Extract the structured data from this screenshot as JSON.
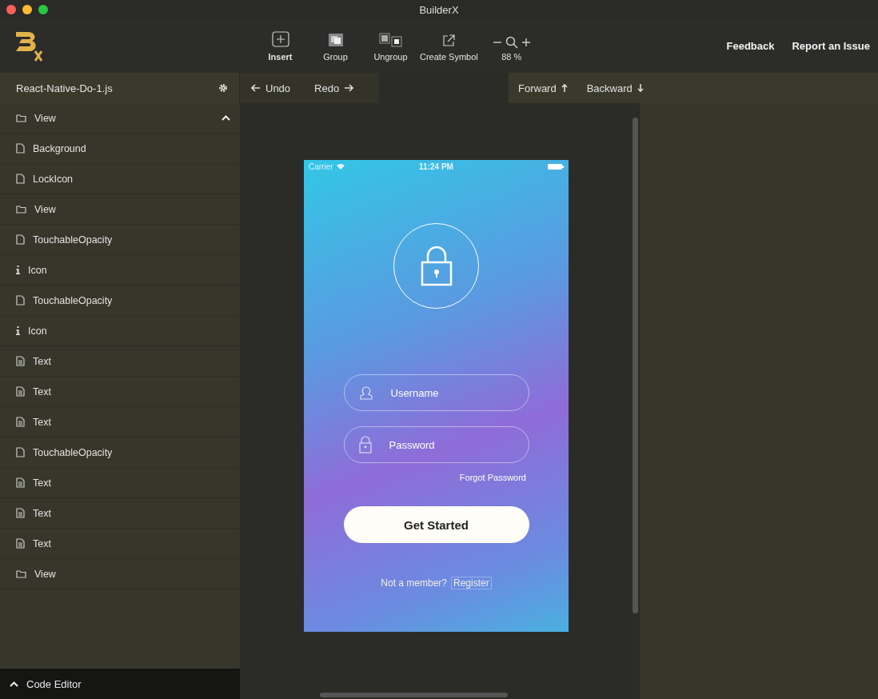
{
  "window": {
    "title": "BuilderX"
  },
  "toolbar": {
    "tools": [
      {
        "label": "Insert",
        "kind": "insert",
        "selected": true
      },
      {
        "label": "Group",
        "kind": "group",
        "selected": false
      },
      {
        "label": "Ungroup",
        "kind": "ungroup",
        "selected": false
      },
      {
        "label": "Create Symbol",
        "kind": "symbol",
        "selected": false
      }
    ],
    "zoom": "88 %",
    "links": [
      "Feedback",
      "Report an Issue"
    ]
  },
  "file": {
    "name": "React-Native-Do-1.js"
  },
  "history": [
    {
      "label": "Undo",
      "kind": "back"
    },
    {
      "label": "Redo",
      "kind": "forward"
    }
  ],
  "arrange": [
    {
      "label": "Forward",
      "kind": "up"
    },
    {
      "label": "Backward",
      "kind": "down"
    }
  ],
  "layers": [
    {
      "label": "View",
      "kind": "folder",
      "expanded": true
    },
    {
      "label": "Background",
      "kind": "file"
    },
    {
      "label": "LockIcon",
      "kind": "file"
    },
    {
      "label": "View",
      "kind": "folder"
    },
    {
      "label": "TouchableOpacity",
      "kind": "file"
    },
    {
      "label": "Icon",
      "kind": "info"
    },
    {
      "label": "TouchableOpacity",
      "kind": "file"
    },
    {
      "label": "Icon",
      "kind": "info"
    },
    {
      "label": "Text",
      "kind": "text"
    },
    {
      "label": "Text",
      "kind": "text"
    },
    {
      "label": "Text",
      "kind": "text"
    },
    {
      "label": "TouchableOpacity",
      "kind": "file"
    },
    {
      "label": "Text",
      "kind": "text"
    },
    {
      "label": "Text",
      "kind": "text"
    },
    {
      "label": "Text",
      "kind": "text"
    },
    {
      "label": "View",
      "kind": "folder"
    }
  ],
  "code_editor": {
    "label": "Code Editor",
    "expanded": false
  },
  "phone": {
    "status_bar": {
      "carrier": "Carrier",
      "time": "11:24 PM"
    },
    "fields": [
      {
        "placeholder": "Username",
        "kind": "user"
      },
      {
        "placeholder": "Password",
        "kind": "lock"
      }
    ],
    "forgot": "Forgot Password",
    "button": "Get Started",
    "footer": "Not a member?",
    "register": "Register"
  }
}
